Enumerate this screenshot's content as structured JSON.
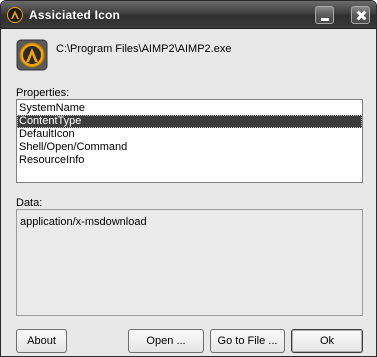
{
  "window": {
    "title": "Assiciated Icon",
    "accent_color": "#f0a400"
  },
  "titlebar_buttons": {
    "minimize_icon": "minimize-icon",
    "close_icon": "close-icon"
  },
  "file": {
    "icon": "aimp-icon",
    "path": "C:\\Program Files\\AIMP2\\AIMP2.exe"
  },
  "properties": {
    "label": "Properties:",
    "items": [
      {
        "label": "SystemName"
      },
      {
        "label": "ContentType",
        "selected": true
      },
      {
        "label": "DefaultIcon"
      },
      {
        "label": "Shell/Open/Command"
      },
      {
        "label": "ResourceInfo"
      }
    ],
    "selection_color": "#3c3c3c"
  },
  "data": {
    "label": "Data:",
    "value": "application/x-msdownload"
  },
  "buttons": {
    "about": "About",
    "open": "Open ...",
    "goto": "Go to File ...",
    "ok": "Ok"
  }
}
